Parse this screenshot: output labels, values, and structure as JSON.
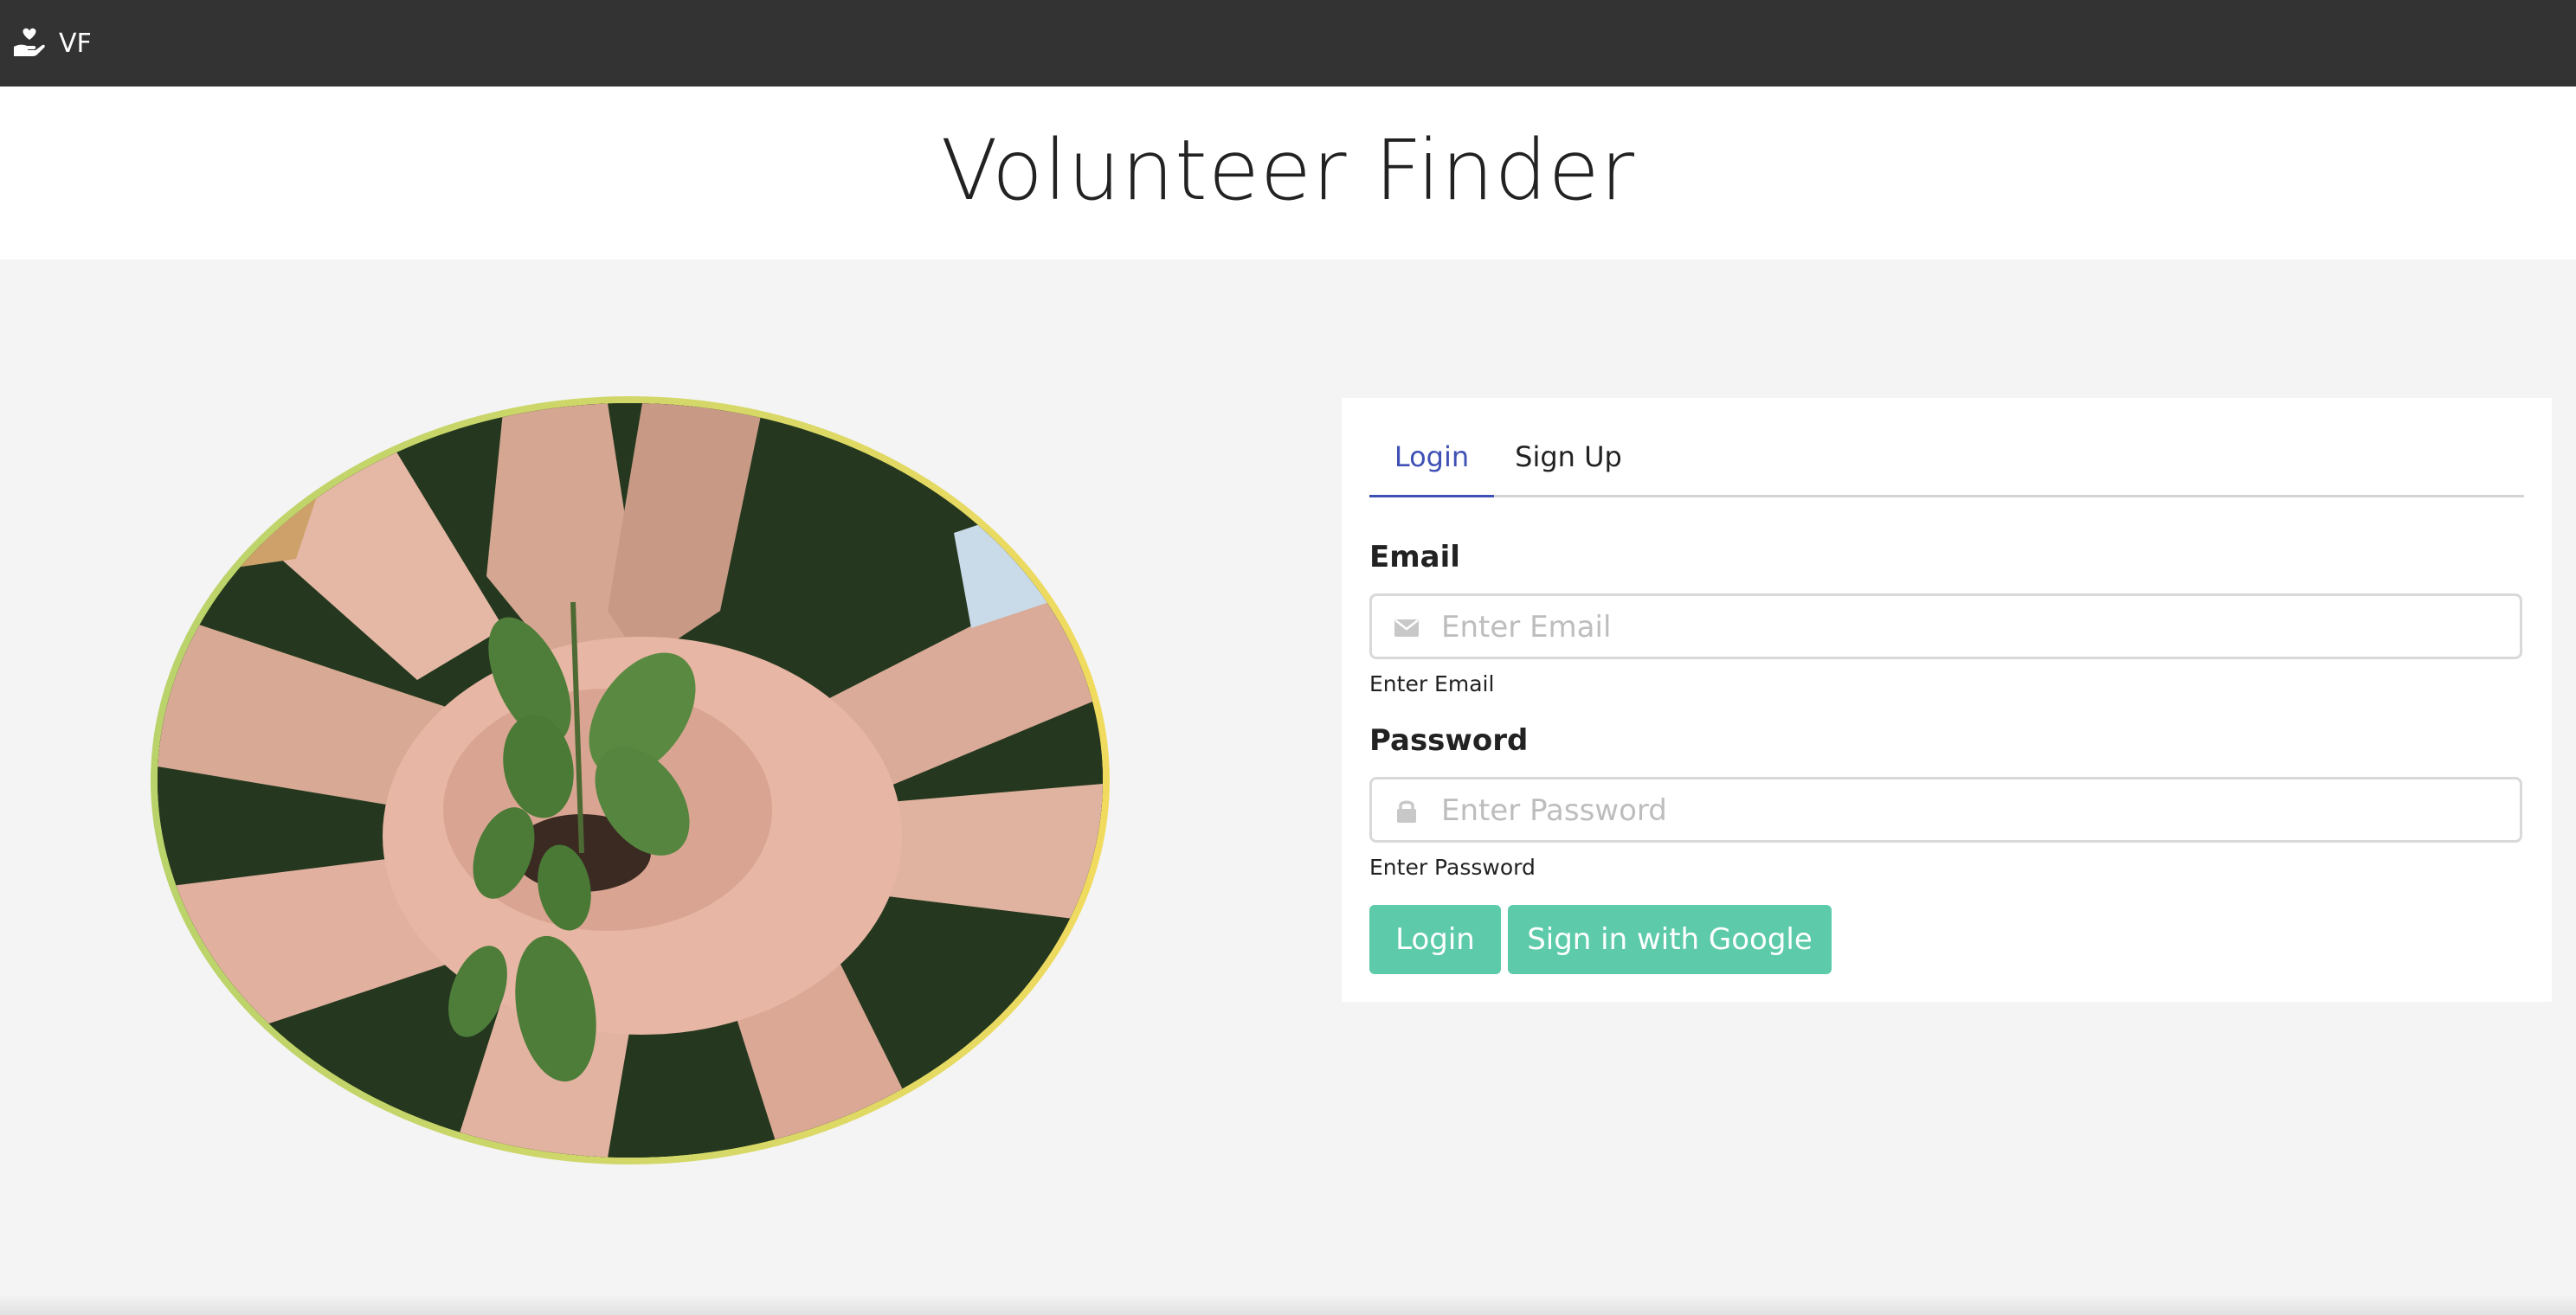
{
  "nav": {
    "brand_label": "VF",
    "brand_icon": "hand-holding-heart-icon"
  },
  "hero": {
    "title": "Volunteer Finder"
  },
  "image": {
    "subject": "photo",
    "border_colors": [
      "#b9d36a",
      "#f1db5e"
    ]
  },
  "auth": {
    "tabs": [
      {
        "label": "Login",
        "active": true
      },
      {
        "label": "Sign Up",
        "active": false
      }
    ],
    "email": {
      "label": "Email",
      "placeholder": "Enter Email",
      "value": "",
      "helper": "Enter Email",
      "icon": "envelope-icon"
    },
    "password": {
      "label": "Password",
      "placeholder": "Enter Password",
      "value": "",
      "helper": "Enter Password",
      "icon": "lock-icon"
    },
    "login_button": "Login",
    "google_button": "Sign in with Google"
  },
  "colors": {
    "topbar": "#333333",
    "accent": "#3f51b5",
    "button": "#5dcbaa",
    "background": "#f4f4f4"
  }
}
